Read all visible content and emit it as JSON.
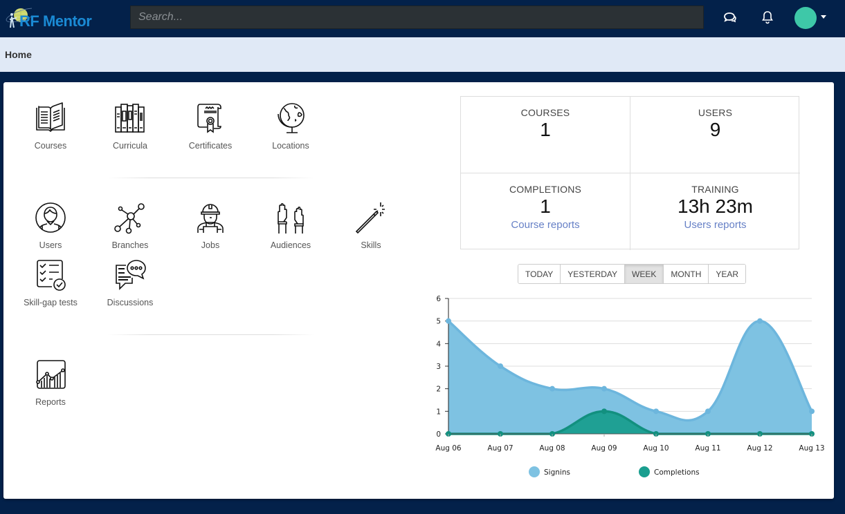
{
  "app": {
    "logo_text": "RF Mentor",
    "search_placeholder": "Search...",
    "header_icons": [
      "chat-icon",
      "bell-icon"
    ],
    "avatar_color": "#3ec8a8"
  },
  "breadcrumb": {
    "current": "Home"
  },
  "tiles": {
    "row1": [
      {
        "label": "Courses",
        "icon": "open-book-icon"
      },
      {
        "label": "Curricula",
        "icon": "books-icon"
      },
      {
        "label": "Certificates",
        "icon": "certificate-icon"
      },
      {
        "label": "Locations",
        "icon": "globe-icon"
      }
    ],
    "row2": [
      {
        "label": "Users",
        "icon": "user-icon"
      },
      {
        "label": "Branches",
        "icon": "network-icon"
      },
      {
        "label": "Jobs",
        "icon": "worker-icon"
      },
      {
        "label": "Audiences",
        "icon": "raised-hands-icon"
      },
      {
        "label": "Skills",
        "icon": "magic-wand-icon"
      }
    ],
    "row3": [
      {
        "label": "Skill-gap tests",
        "icon": "checklist-icon"
      },
      {
        "label": "Discussions",
        "icon": "speech-bubble-icon"
      }
    ],
    "row4": [
      {
        "label": "Reports",
        "icon": "line-chart-icon"
      }
    ]
  },
  "stats": {
    "courses": {
      "title": "COURSES",
      "value": "1"
    },
    "users": {
      "title": "USERS",
      "value": "9"
    },
    "completions": {
      "title": "COMPLETIONS",
      "value": "1",
      "link": "Course reports"
    },
    "training": {
      "title": "TRAINING",
      "value": "13h 23m",
      "link": "Users reports"
    }
  },
  "period": {
    "options": [
      "TODAY",
      "YESTERDAY",
      "WEEK",
      "MONTH",
      "YEAR"
    ],
    "selected": "WEEK"
  },
  "chart_data": {
    "type": "area",
    "categories": [
      "Aug 06",
      "Aug 07",
      "Aug 08",
      "Aug 09",
      "Aug 10",
      "Aug 11",
      "Aug 12",
      "Aug 13"
    ],
    "series": [
      {
        "name": "Signins",
        "values": [
          5,
          3,
          2,
          2,
          1,
          1,
          5,
          1
        ],
        "color": "#7ec2e2",
        "line_color": "#6db6dd"
      },
      {
        "name": "Completions",
        "values": [
          0,
          0,
          0,
          1,
          0,
          0,
          0,
          0
        ],
        "color": "#1a9e8f",
        "line_color": "#12907f"
      }
    ],
    "ylim": [
      0,
      6
    ],
    "yticks": [
      0,
      1,
      2,
      3,
      4,
      5,
      6
    ],
    "grid": true,
    "legend": "bottom",
    "smooth": true,
    "title": "",
    "xlabel": "",
    "ylabel": ""
  }
}
